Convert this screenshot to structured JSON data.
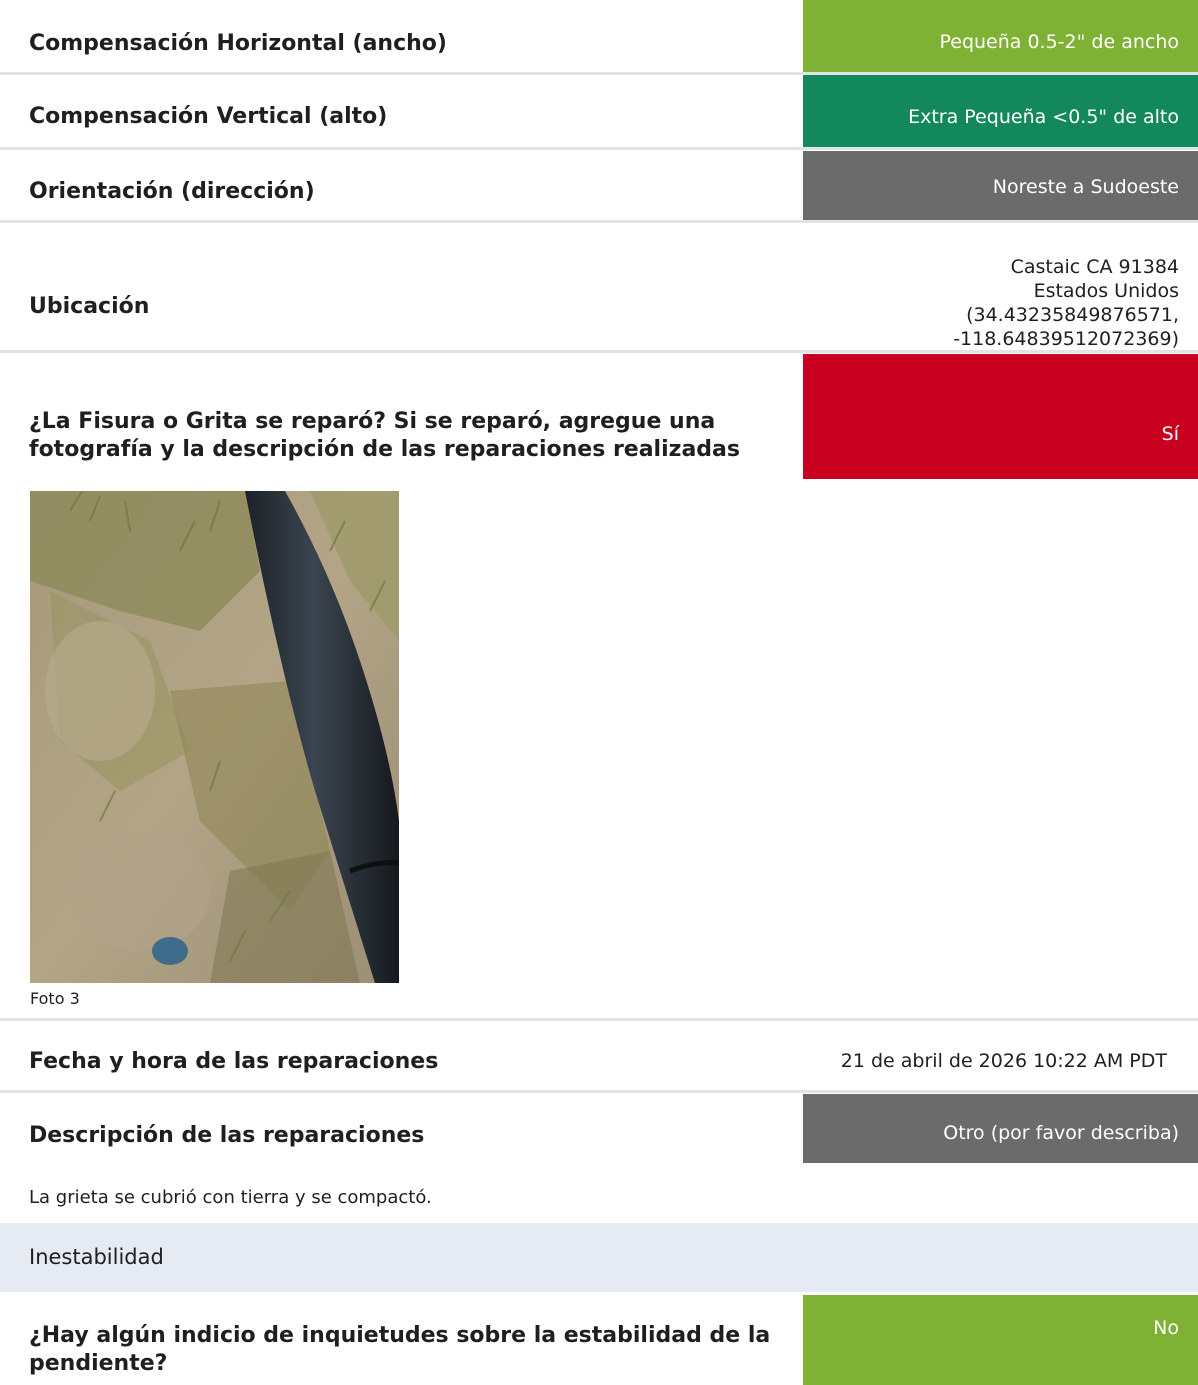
{
  "rows": {
    "horizontal": {
      "label": "Compensación Horizontal (ancho)",
      "value": "Pequeña 0.5-2\" de ancho",
      "color": "#7fb135"
    },
    "vertical": {
      "label": "Compensación Vertical (alto)",
      "value": "Extra Pequeña <0.5\" de alto",
      "color": "#14885d"
    },
    "orientation": {
      "label": "Orientación (dirección)",
      "value": "Noreste a Sudoeste",
      "color": "#6b6b6b"
    },
    "location": {
      "label": "Ubicación",
      "lines": [
        "Castaic CA 91384",
        "Estados Unidos",
        "(34.43235849876571,",
        "-118.64839512072369)"
      ]
    },
    "repaired": {
      "label_line1": "¿La Fisura o Grita se reparó? Si se reparó, agregue una",
      "label_line2": "fotografía y la descripción de las reparaciones realizadas",
      "value": "Sí",
      "color": "#c9001f"
    },
    "photo_caption": "Foto 3",
    "repair_datetime": {
      "label": "Fecha y hora de las reparaciones",
      "value": "21 de abril de 2026 10:22 AM PDT"
    },
    "repair_description": {
      "label": "Descripción de las reparaciones",
      "value": "Otro (por favor describa)",
      "color": "#6b6b6b",
      "text": "La grieta se cubrió con tierra y se compactó."
    }
  },
  "section": {
    "title": "Inestabilidad"
  },
  "stability": {
    "label_line1": "¿Hay algún indicio de inquietudes sobre la estabilidad de la",
    "label_line2": "pendiente?",
    "value": "No",
    "color": "#7fb135"
  }
}
